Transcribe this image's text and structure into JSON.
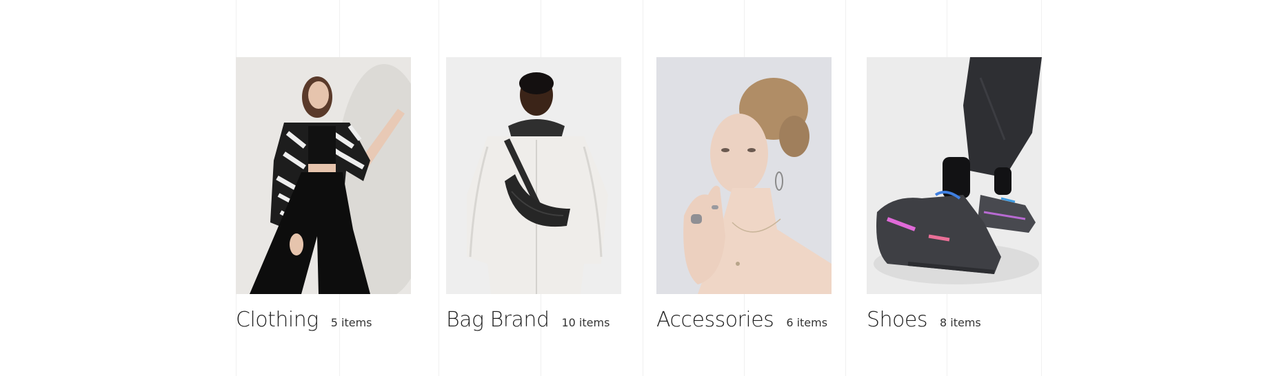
{
  "categories": [
    {
      "name": "Clothing",
      "count": "5 items",
      "image": "woman-zebra-jacket-photo"
    },
    {
      "name": "Bag Brand",
      "count": "10 items",
      "image": "man-crossbody-bag-photo"
    },
    {
      "name": "Accessories",
      "count": "6 items",
      "image": "woman-rings-earrings-photo"
    },
    {
      "name": "Shoes",
      "count": "8 items",
      "image": "chunky-sneakers-photo"
    }
  ]
}
